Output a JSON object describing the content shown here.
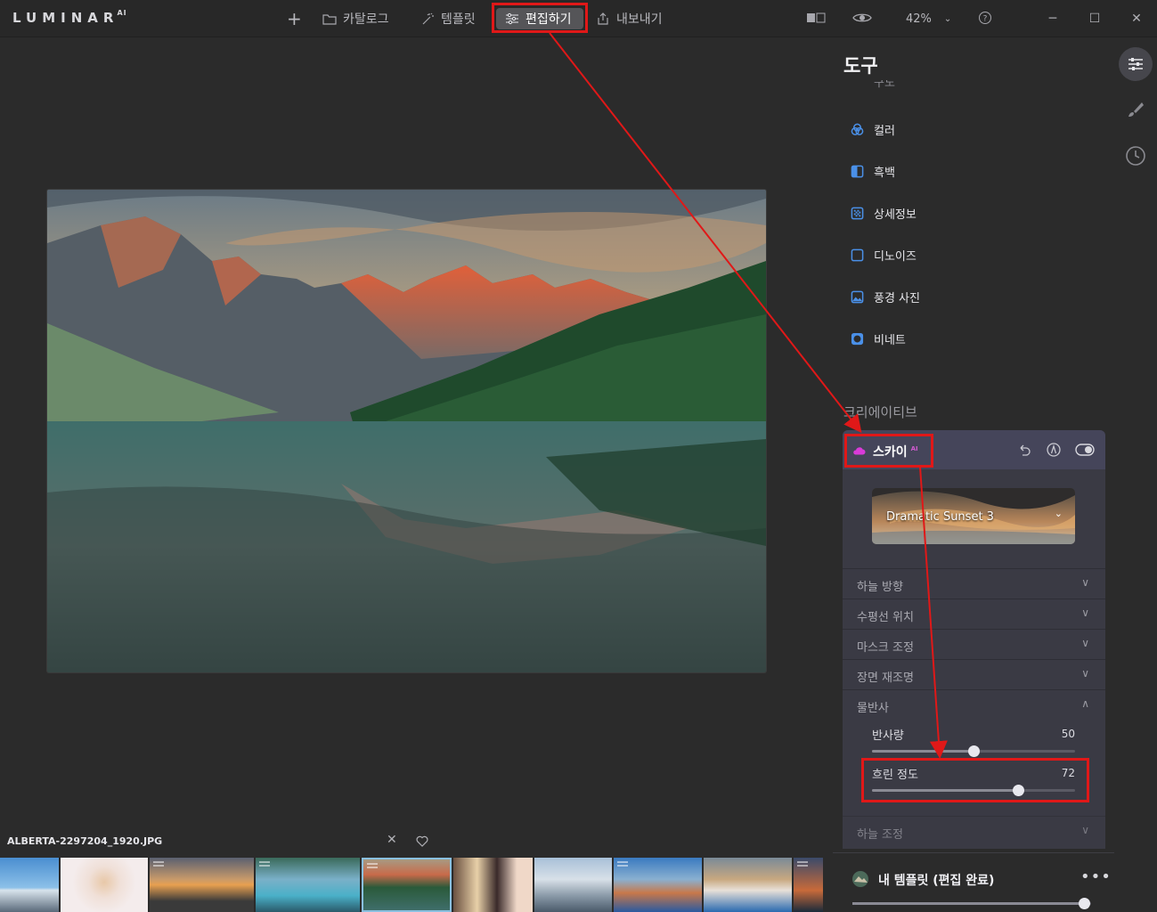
{
  "app": {
    "logo_text": "LUMINAR",
    "logo_super": "AI"
  },
  "topbar": {
    "add_label": "+",
    "catalog_label": "카탈로그",
    "templates_label": "템플릿",
    "edit_label": "편집하기",
    "export_label": "내보내기",
    "zoom_value": "42%"
  },
  "tools": {
    "title": "도구",
    "partial_item": "구도",
    "items": [
      {
        "label": "컬러",
        "icon": "color-icon"
      },
      {
        "label": "흑백",
        "icon": "bw-icon"
      },
      {
        "label": "상세정보",
        "icon": "details-icon"
      },
      {
        "label": "디노이즈",
        "icon": "denoise-icon"
      },
      {
        "label": "풍경 사진",
        "icon": "landscape-icon"
      },
      {
        "label": "비네트",
        "icon": "vignette-icon"
      }
    ],
    "creative_label": "크리에이티브"
  },
  "sky": {
    "title": "스카이",
    "badge": "AI",
    "preset_name": "Dramatic Sunset 3",
    "sections": [
      {
        "label": "하늘 방향",
        "state": "collapsed"
      },
      {
        "label": "수평선 위치",
        "state": "collapsed"
      },
      {
        "label": "마스크 조정",
        "state": "collapsed"
      },
      {
        "label": "장면 재조명",
        "state": "collapsed"
      },
      {
        "label": "물반사",
        "state": "expanded"
      },
      {
        "label": "하늘 조정",
        "state": "collapsed"
      }
    ],
    "sliders": [
      {
        "label": "반사량",
        "value": "50",
        "fraction": 0.5
      },
      {
        "label": "흐린 정도",
        "value": "72",
        "fraction": 0.72
      }
    ]
  },
  "templates_bar": {
    "label": "내 템플릿 (편집 완료)",
    "menu": "•••",
    "slider_fraction": 0.97
  },
  "filmstrip": {
    "filename": "ALBERTA-2297204_1920.JPG"
  },
  "colors": {
    "annotation": "#e01818",
    "accent_blue": "#4a90e8",
    "sky_pink": "#d93bd9"
  }
}
